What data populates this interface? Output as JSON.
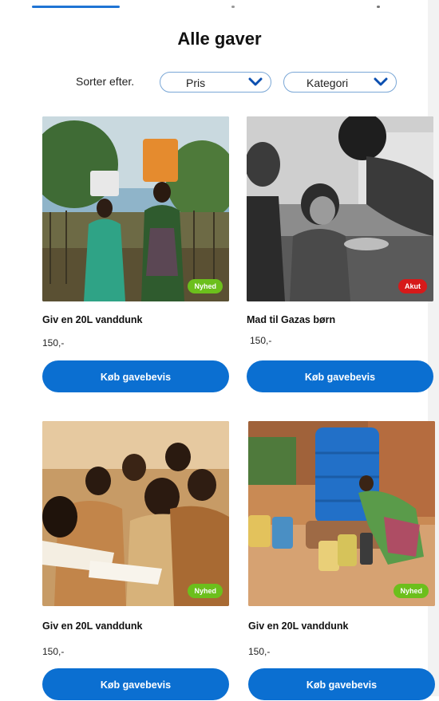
{
  "header": {
    "title": "Alle gaver"
  },
  "filters": {
    "sort_label": "Sorter efter.",
    "price_select": "Pris",
    "category_select": "Kategori"
  },
  "colors": {
    "accent": "#0b6fd1",
    "badge_new": "#6cbf1c",
    "badge_urgent": "#d61a1a"
  },
  "products": [
    {
      "title": "Giv en 20L vanddunk",
      "price": "150,-",
      "badge": "Nyhed",
      "button": "Køb gavebevis"
    },
    {
      "title": "Mad til Gazas børn",
      "price": "150,-",
      "badge": "Akut",
      "button": "Køb gavebevis"
    },
    {
      "title": "Giv en 20L vanddunk",
      "price": "150,-",
      "badge": "Nyhed",
      "button": "Køb gavebevis"
    },
    {
      "title": "Giv en 20L vanddunk",
      "price": "150,-",
      "badge": "Nyhed",
      "button": "Køb gavebevis"
    }
  ]
}
